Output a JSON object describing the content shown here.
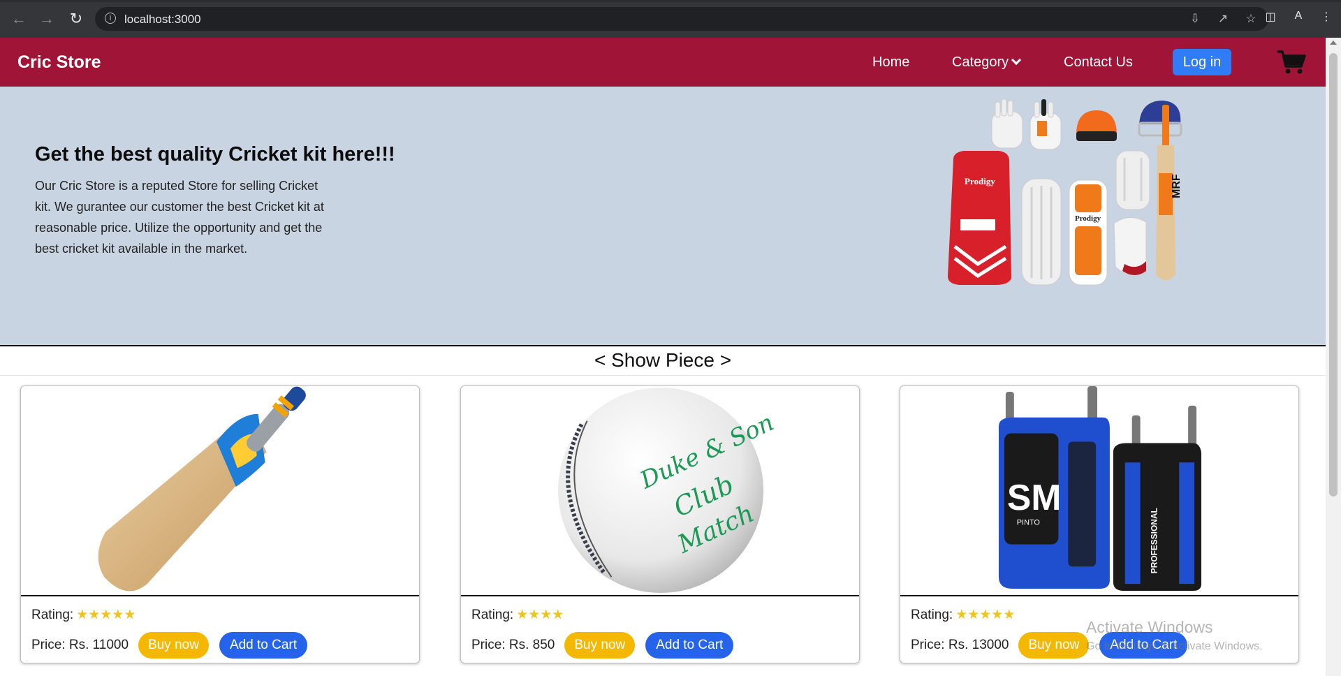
{
  "browser": {
    "url": "localhost:3000",
    "profile_initial": "A"
  },
  "navbar": {
    "brand": "Cric Store",
    "links": {
      "home": "Home",
      "category": "Category",
      "contact": "Contact Us"
    },
    "login_label": "Log in"
  },
  "hero": {
    "title": "Get the best quality Cricket kit here!!!",
    "description": "Our Cric Store is a reputed Store for selling Cricket kit. We gurantee our customer the best Cricket kit at reasonable price. Utilize the opportunity and get the best cricket kit available in the market.",
    "image_labels": {
      "bag_brand": "Prodigy",
      "pad_brand": "Prodigy",
      "bat_brand": "MRF"
    }
  },
  "showcase": {
    "title": "< Show Piece >",
    "rating_label": "Rating:",
    "buy_label": "Buy now",
    "cart_label": "Add to Cart",
    "products": [
      {
        "stars": "★★★★★",
        "rating": 5,
        "price": "Price: Rs. 11000"
      },
      {
        "stars": "★★★★",
        "rating": 4,
        "price": "Price: Rs. 850",
        "image_text": {
          "line1": "Duke & Son",
          "line2": "Club",
          "line3": "Match"
        }
      },
      {
        "stars": "★★★★★",
        "rating": 5,
        "price": "Price: Rs. 13000",
        "image_text": {
          "logo": "SM",
          "sub": "PINTO",
          "side": "PROFESSIONAL"
        }
      }
    ]
  },
  "watermark": {
    "title": "Activate Windows",
    "subtitle": "Go to Settings to activate Windows."
  },
  "colors": {
    "navbar": "#a01437",
    "hero_bg": "#c9d4e2",
    "login": "#2f7cf6",
    "buy": "#f5b800",
    "cart": "#2563eb",
    "stars": "#f0c419"
  }
}
